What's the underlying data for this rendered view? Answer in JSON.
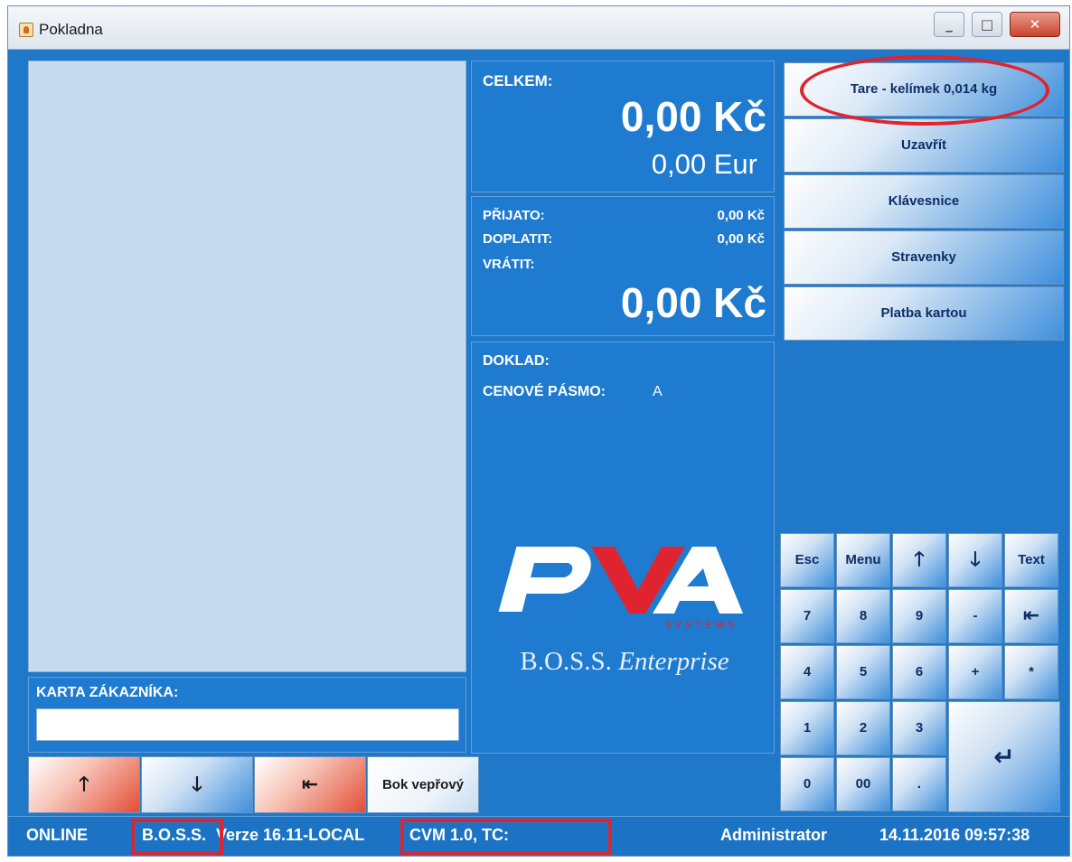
{
  "window": {
    "title": "Pokladna"
  },
  "titlebar_buttons": {
    "minimize_icon": "minimize-icon",
    "maximize_icon": "maximize-icon",
    "close_icon": "close-icon"
  },
  "totals": {
    "celkem_label": "CELKEM:",
    "amount_czk": "0,00 Kč",
    "amount_eur": "0,00 Eur"
  },
  "payment": {
    "prijato_label": "PŘIJATO:",
    "prijato_value": "0,00 Kč",
    "doplatit_label": "DOPLATIT:",
    "doplatit_value": "0,00 Kč",
    "vratit_label": "VRÁTIT:",
    "vratit_amount": "0,00 Kč"
  },
  "document": {
    "doklad_label": "DOKLAD:",
    "pasmo_label": "CENOVÉ PÁSMO:",
    "pasmo_value": "A"
  },
  "logo": {
    "brand": "PVA",
    "sub": "SYSTEMS",
    "product": "B.O.S.S.",
    "product_suffix": "Enterprise"
  },
  "function_buttons": [
    "Tare - kelímek 0,014 kg",
    "Uzavřít",
    "Klávesnice",
    "Stravenky",
    "Platba kartou"
  ],
  "keypad": {
    "esc": "Esc",
    "menu": "Menu",
    "text": "Text",
    "k7": "7",
    "k8": "8",
    "k9": "9",
    "minus": "-",
    "k4": "4",
    "k5": "5",
    "k6": "6",
    "plus": "+",
    "star": "*",
    "k1": "1",
    "k2": "2",
    "k3": "3",
    "k0": "0",
    "k00": "00",
    "dot": "."
  },
  "customer": {
    "label": "KARTA ZÁKAZNÍKA:",
    "value": ""
  },
  "nav": {
    "product_button": "Bok vepřový"
  },
  "status": {
    "online": "ONLINE",
    "boss": "B.O.S.S.",
    "version": "Verze 16.11-LOCAL",
    "cvm": "CVM 1.0, TC:",
    "user": "Administrator",
    "datetime": "14.11.2016 09:57:38"
  },
  "colors": {
    "background": "#1f78c8",
    "accent_red": "#e0242f",
    "list_bg": "#c6daf0"
  }
}
